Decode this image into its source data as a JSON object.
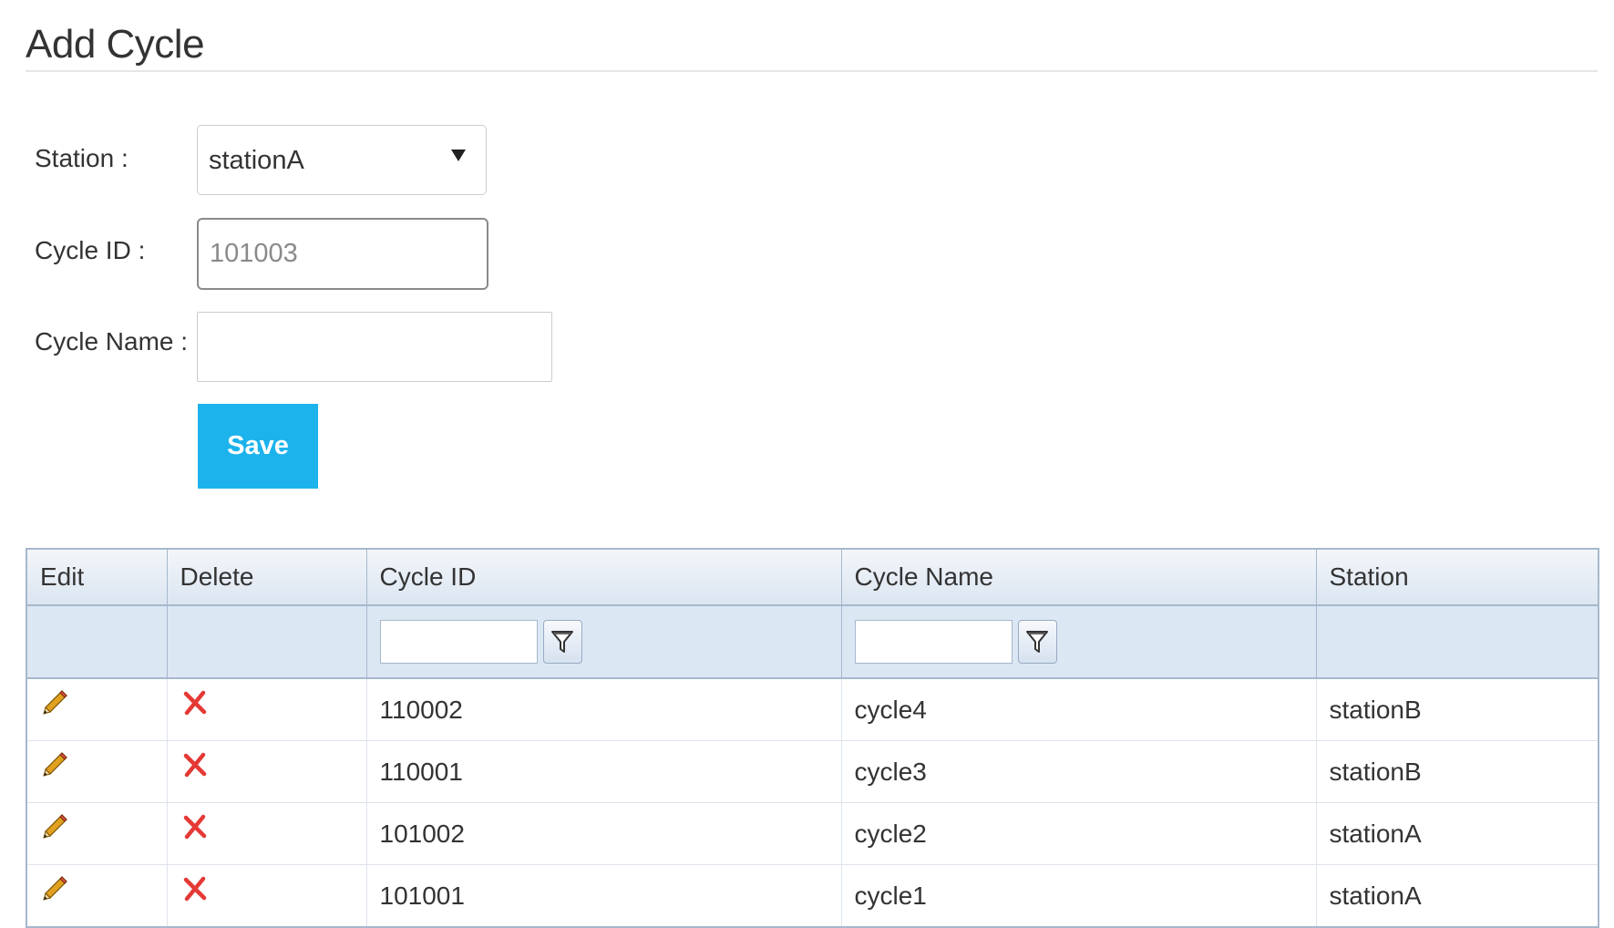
{
  "page": {
    "title": "Add Cycle"
  },
  "form": {
    "station_label": "Station :",
    "station_value": "stationA",
    "cycle_id_label": "Cycle ID :",
    "cycle_id_placeholder": "101003",
    "cycle_name_label": "Cycle Name :",
    "cycle_name_value": "",
    "save_label": "Save"
  },
  "grid": {
    "columns": [
      "Edit",
      "Delete",
      "Cycle ID",
      "Cycle Name",
      "Station"
    ],
    "rows": [
      {
        "cycle_id": "110002",
        "cycle_name": "cycle4",
        "station": "stationB"
      },
      {
        "cycle_id": "110001",
        "cycle_name": "cycle3",
        "station": "stationB"
      },
      {
        "cycle_id": "101002",
        "cycle_name": "cycle2",
        "station": "stationA"
      },
      {
        "cycle_id": "101001",
        "cycle_name": "cycle1",
        "station": "stationA"
      }
    ],
    "icons": {
      "edit": "pencil-icon",
      "delete": "red-x-icon",
      "filter": "filter-funnel-icon",
      "select_arrow": "triangle-down-icon"
    }
  },
  "colors": {
    "save_button": "#1cb3ec",
    "grid_header": "#dbe5f1",
    "grid_border": "#a6b8cc",
    "delete_icon": "#e53935",
    "edit_icon": "#e0a020"
  }
}
